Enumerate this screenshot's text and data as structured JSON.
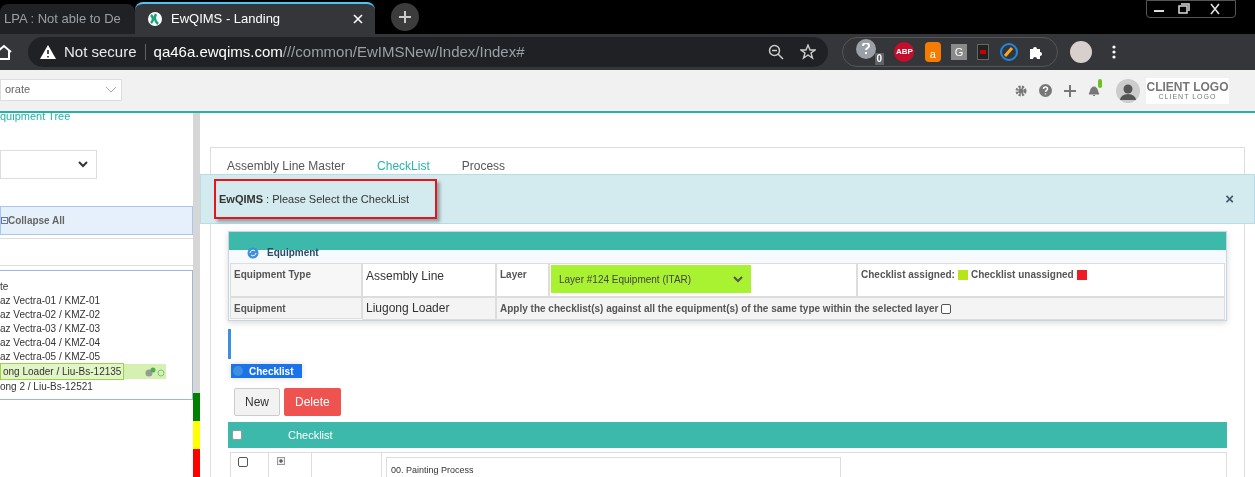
{
  "browser": {
    "tabs": [
      {
        "label": "LPA : Not able to De",
        "selected": false
      },
      {
        "label": "EwQIMS - Landing",
        "selected": true
      }
    ],
    "security": "Not secure",
    "url_host": "qa46a.ewqims.com",
    "url_path": "///common/EwIMSNew/Index/Index#",
    "extensions": [
      {
        "kind": "shield",
        "label": "0"
      },
      {
        "kind": "abp",
        "label": "ABP"
      },
      {
        "kind": "bag",
        "label": "a"
      },
      {
        "kind": "g",
        "label": "G"
      },
      {
        "kind": "doc"
      },
      {
        "kind": "brush"
      },
      {
        "kind": "puzzle"
      }
    ]
  },
  "header": {
    "plant_select": "orate",
    "notifications": true,
    "logo": "CLIENT LOGO",
    "logo_sub": "CLIENT LOGO"
  },
  "sidebar": {
    "title": "quipment Tree",
    "collapse_all": "Collapse All",
    "tree": [
      {
        "label": "te",
        "selected": false
      },
      {
        "label": "az Vectra-01 / KMZ-01",
        "selected": false
      },
      {
        "label": "az Vectra-02 / KMZ-02",
        "selected": false
      },
      {
        "label": "az Vectra-03 / KMZ-03",
        "selected": false
      },
      {
        "label": "az Vectra-04 / KMZ-04",
        "selected": false
      },
      {
        "label": "az Vectra-05 / KMZ-05",
        "selected": false
      },
      {
        "label": "ong Loader / Liu-Bs-12135",
        "selected": true
      },
      {
        "label": "ong 2 / Liu-Bs-12521",
        "selected": false
      }
    ],
    "status_colors": [
      {
        "color": "#008000"
      },
      {
        "color": "#ffff00"
      },
      {
        "color": "#ff0000"
      }
    ]
  },
  "tabs": [
    {
      "label": "Assembly Line Master",
      "selected": false
    },
    {
      "label": "CheckList",
      "selected": true
    },
    {
      "label": "Process",
      "selected": false
    }
  ],
  "alert": {
    "text": "**EwQIMS** : Please Select the CheckList",
    "close": "×"
  },
  "equipment": {
    "title": "Equipment",
    "type_label": "Equipment Type",
    "type_value": "Assembly Line",
    "layer_label": "Layer",
    "layer_value": "Layer #124 Equipment (ITAR)",
    "legend": [
      {
        "label": "Checklist assigned:",
        "color": "#b5e61d"
      },
      {
        "label": "Checklist unassigned",
        "color": "#ed1c24"
      }
    ],
    "equipment_label": "Equipment",
    "equipment_value": "Liugong Loader",
    "apply_label": "Apply the checklist(s) against all the equipment(s) of the same type within the selected layer",
    "apply_checked": false
  },
  "checklist": {
    "title": "Checklist",
    "buttons": [
      {
        "label": "New",
        "kind": "default"
      },
      {
        "label": "Delete",
        "kind": "danger"
      }
    ],
    "header": "Checklist",
    "header_checked": false,
    "rows": [
      {
        "name": "00. Painting Process",
        "checked": false,
        "expanded": false
      }
    ]
  }
}
